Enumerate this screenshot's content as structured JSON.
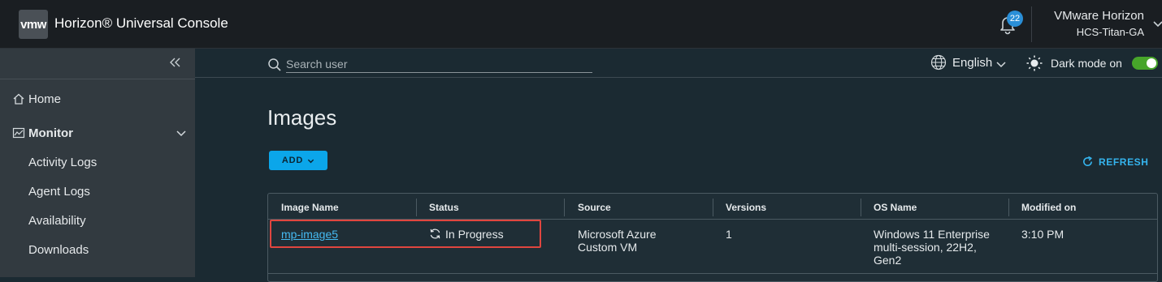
{
  "header": {
    "logo_text": "vmw",
    "app_title": "Horizon® Universal Console",
    "notification_count": "22",
    "org_name": "VMware Horizon",
    "org_sub": "HCS-Titan-GA"
  },
  "sidebar": {
    "items": [
      {
        "label": "Home",
        "icon": "home-icon"
      },
      {
        "label": "Monitor",
        "icon": "chart-icon"
      },
      {
        "label": "Activity Logs"
      },
      {
        "label": "Agent Logs"
      },
      {
        "label": "Availability"
      },
      {
        "label": "Downloads"
      }
    ]
  },
  "topbar": {
    "search_placeholder": "Search user",
    "language": "English",
    "dark_mode_label": "Dark mode on",
    "dark_mode_on": true
  },
  "main": {
    "title": "Images",
    "add_label": "ADD",
    "refresh_label": "REFRESH"
  },
  "table": {
    "columns": [
      "Image Name",
      "Status",
      "Source",
      "Versions",
      "OS Name",
      "Modified on"
    ],
    "rows": [
      {
        "image_name": "mp-image5",
        "status": "In Progress",
        "source_line1": "Microsoft Azure",
        "source_line2": "Custom VM",
        "versions": "1",
        "os_line1": "Windows 11 Enterprise",
        "os_line2": "multi-session, 22H2,",
        "os_line3": "Gen2",
        "modified": "3:10 PM"
      }
    ]
  },
  "colors": {
    "accent": "#0ba6ea",
    "link": "#45baf2",
    "toggle_on": "#47a52a",
    "highlight": "#e0463f"
  }
}
